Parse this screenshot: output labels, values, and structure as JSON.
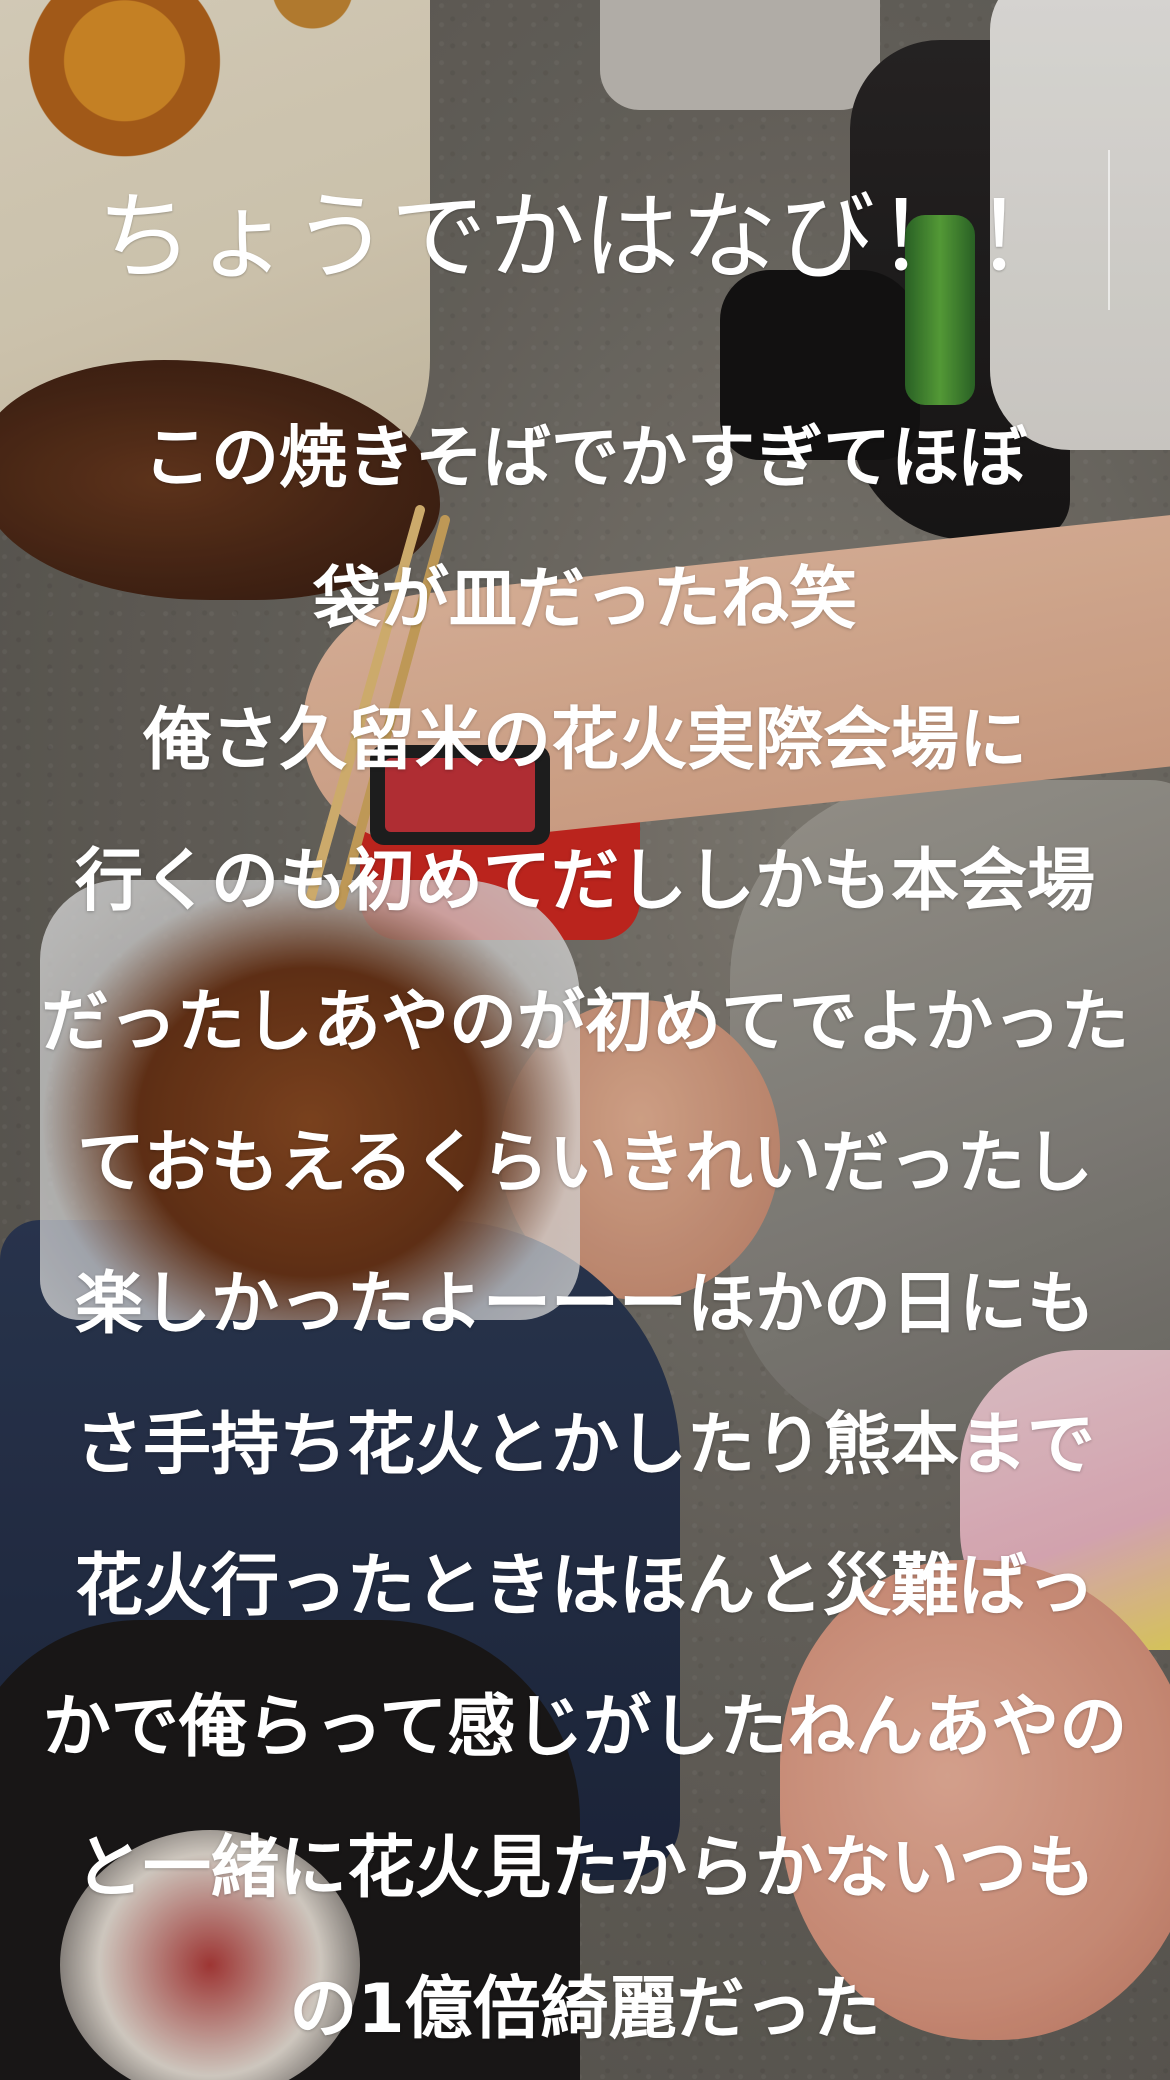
{
  "story": {
    "title": "ちょうでかはなび！！",
    "caption_lines": [
      "この焼きそばでかすぎてほぼ",
      "袋が皿だったね笑",
      "俺さ久留米の花火実際会場に",
      "行くのも初めてだししかも本会場",
      "だったしあやのが初めてでよかった",
      "ておもえるくらいきれいだったし",
      "楽しかったよーーーほかの日にも",
      "さ手持ち花火とかしたり熊本まで",
      "花火行ったときはほんと災難ばっ",
      "かで俺らって感じがしたねんあやの",
      "と一緒に花火見たからかないつも",
      "の1億倍綺麗だった"
    ],
    "text_color": "#ffffff"
  },
  "photo": {
    "description_tags": [
      "yakisoba-in-plastic-bag",
      "chopsticks",
      "hand",
      "jeans",
      "pavement",
      "red-bag",
      "phone",
      "green-bottle"
    ]
  }
}
